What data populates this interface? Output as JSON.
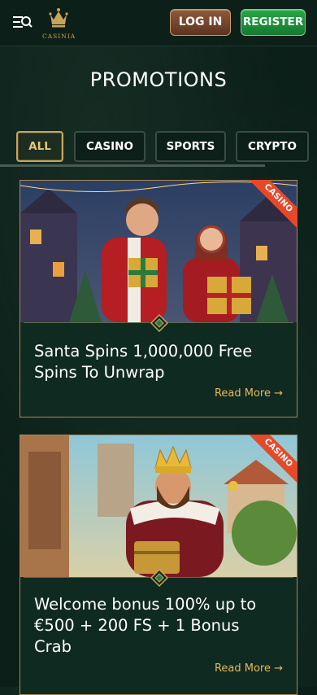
{
  "header": {
    "logo_text": "CASINIA",
    "login_label": "LOG IN",
    "register_label": "REGISTER"
  },
  "page_title": "PROMOTIONS",
  "tabs": [
    {
      "label": "ALL",
      "active": true
    },
    {
      "label": "CASINO",
      "active": false
    },
    {
      "label": "SPORTS",
      "active": false
    },
    {
      "label": "CRYPTO",
      "active": false
    }
  ],
  "promotions": [
    {
      "badge": "CASINO",
      "title": "Santa Spins 1,000,000 Free Spins To Unwrap",
      "read_more": "Read More →",
      "image_icon": "santa-couple-with-gifts"
    },
    {
      "badge": "CASINO",
      "title": "Welcome bonus 100% up to €500 + 200 FS + 1 Bonus Crab",
      "read_more": "Read More →",
      "image_icon": "king-with-treasure-chest"
    }
  ],
  "colors": {
    "background": "#0c1f19",
    "accent_gold": "#c9a558",
    "register_green": "#28a548",
    "login_brown": "#8e5a3c",
    "badge_red": "#e8482a",
    "read_more": "#e8b85a"
  }
}
